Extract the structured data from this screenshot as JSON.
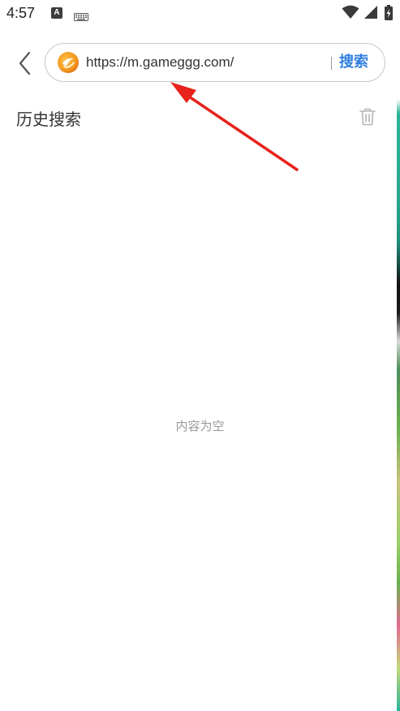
{
  "status_bar": {
    "time": "4:57",
    "notification_letter": "A",
    "icons": [
      "keyboard-icon",
      "wifi-icon",
      "signal-icon",
      "battery-charging-icon"
    ]
  },
  "header": {
    "back_icon": "chevron-left-icon",
    "logo_icon": "browser-logo-icon",
    "search_value": "https://m.gameggg.com/",
    "search_button_label": "搜索"
  },
  "history": {
    "title": "历史搜索",
    "clear_icon": "trash-icon",
    "empty_text": "内容为空"
  },
  "colors": {
    "accent": "#2f7fe0",
    "annotation_arrow": "#e8231c",
    "logo_orange": "#f39a1e"
  }
}
